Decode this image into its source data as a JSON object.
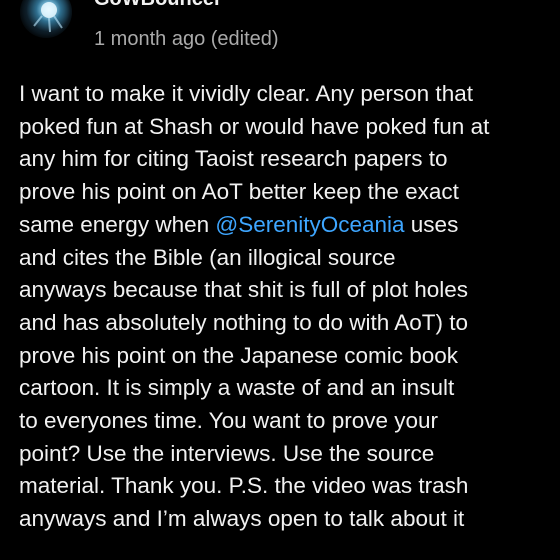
{
  "comment": {
    "author": "GoWBouncer",
    "meta": "1 month ago (edited)",
    "mention": "@SerenityOceania",
    "lines": [
      "I want to make it vividly clear. Any person that",
      "poked fun at Shash or would have poked fun at",
      "any him for citing Taoist research papers to",
      "prove his point on AoT better keep the exact",
      "same energy when ",
      " uses",
      "and cites the Bible (an illogical source",
      "anyways because that shit is full of plot holes",
      "and has absolutely nothing to do with AoT) to",
      "prove his point on the Japanese comic book",
      "cartoon. It is simply a waste of and an insult",
      "to everyones time. You want to prove your",
      "point? Use the interviews. Use the source",
      "material. Thank you. P.S. the video was trash",
      "anyways and I’m always open to talk about it"
    ]
  },
  "colors": {
    "background": "#000000",
    "text": "#f1f1f1",
    "meta": "#aaaaaa",
    "mention": "#3ea6ff"
  },
  "icons": {
    "avatar": "user-avatar-image"
  }
}
